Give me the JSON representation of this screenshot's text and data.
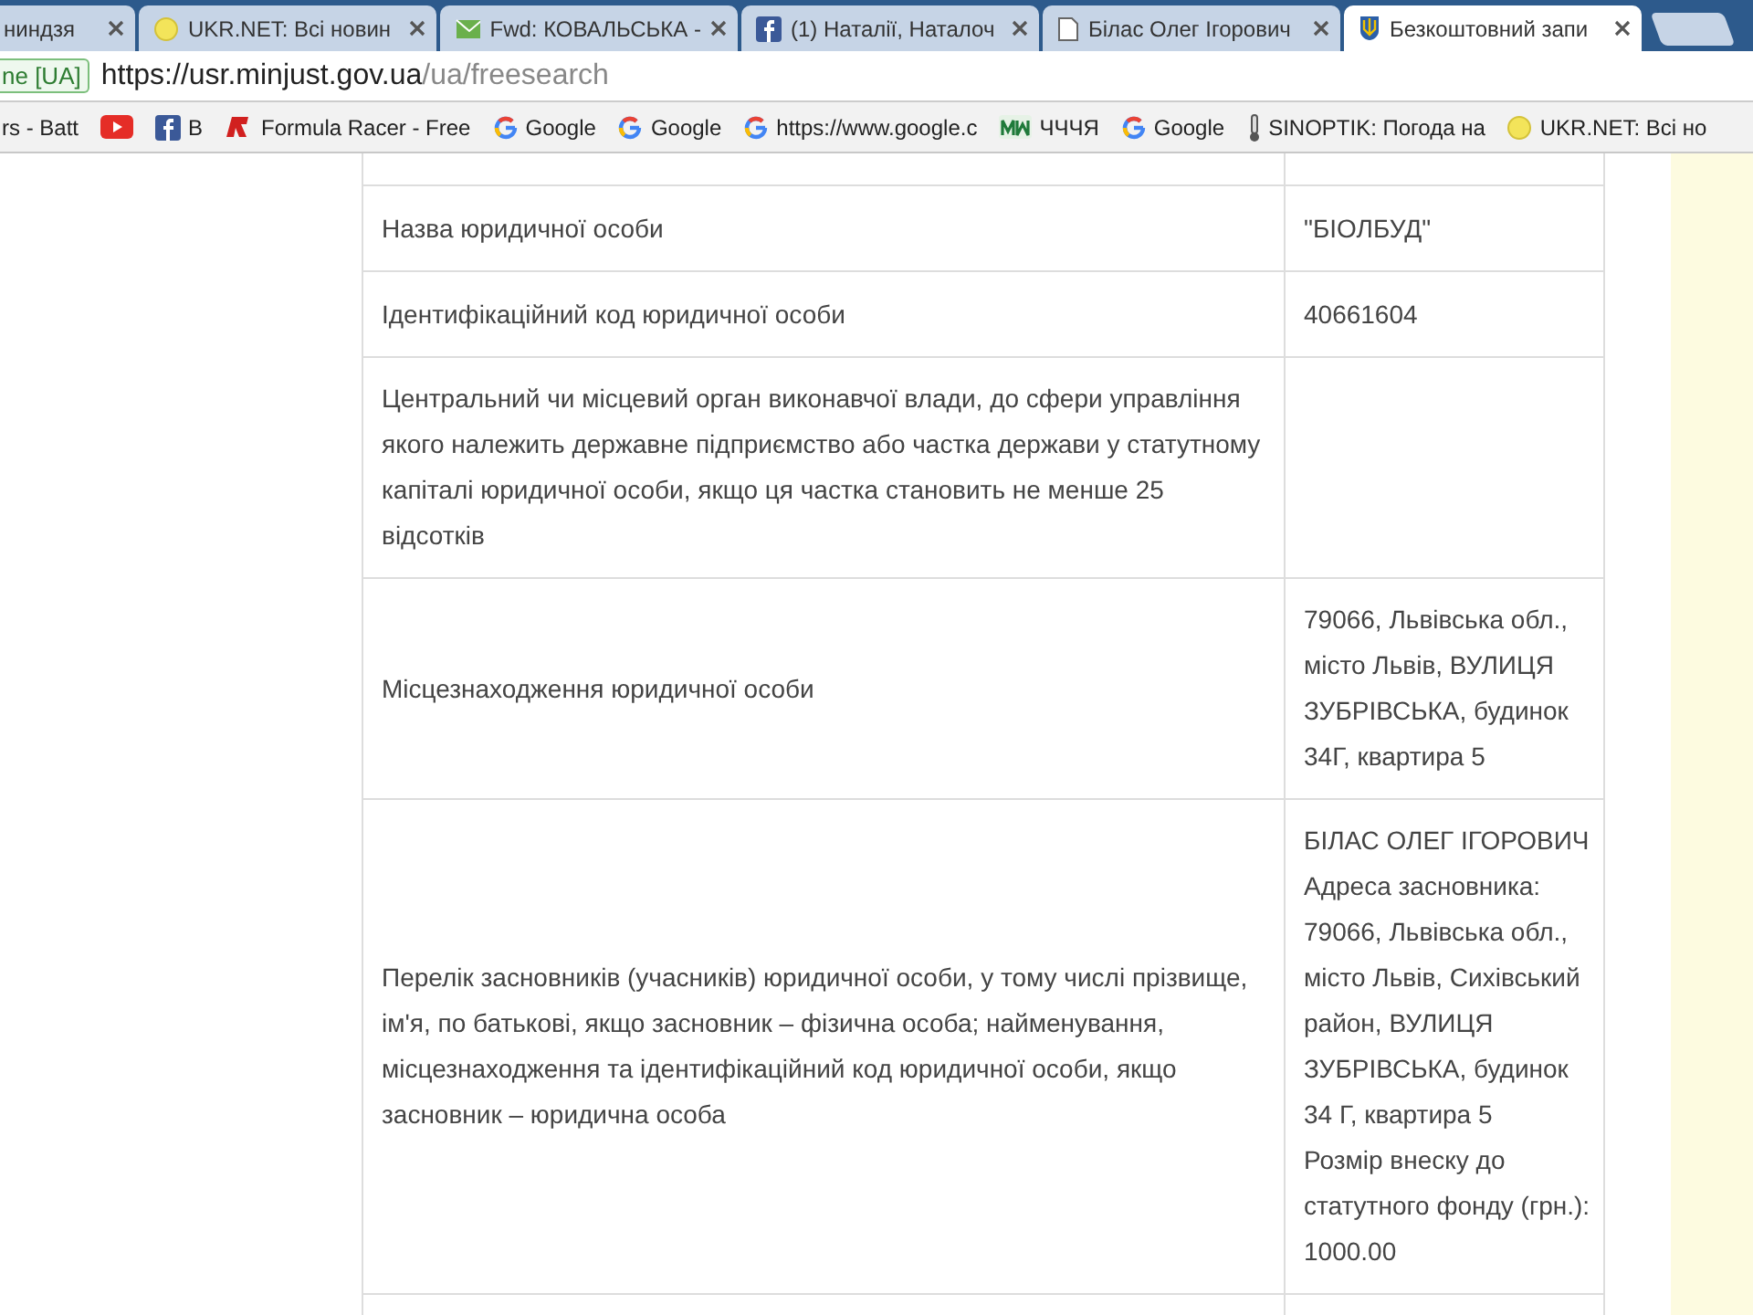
{
  "tabs": [
    {
      "title": "ниндзя",
      "kind": "plain",
      "selected": false
    },
    {
      "title": "UKR.NET: Всі новин",
      "kind": "ukrnet",
      "selected": false
    },
    {
      "title": "Fwd: КОВАЛЬСЬКА -",
      "kind": "mail",
      "selected": false
    },
    {
      "title": "(1) Наталії, Наталоч",
      "kind": "facebook",
      "selected": false
    },
    {
      "title": "Білас Олег Ігорович",
      "kind": "page",
      "selected": false
    },
    {
      "title": "Безкоштовний запи",
      "kind": "arms",
      "selected": true
    }
  ],
  "address_bar": {
    "security_chip": "ne [UA]",
    "url_host": "https://usr.minjust.gov.ua",
    "url_path": "/ua/freesearch"
  },
  "bookmarks": [
    {
      "label": "rs - Batt",
      "kind": "plain"
    },
    {
      "kind": "youtube"
    },
    {
      "label": "B",
      "kind": "facebook"
    },
    {
      "label": "Formula Racer - Free",
      "kind": "racer"
    },
    {
      "label": "Google",
      "kind": "google"
    },
    {
      "label": "Google",
      "kind": "google"
    },
    {
      "label": "https://www.google.c",
      "kind": "google"
    },
    {
      "label": "ЧЧЧЯ",
      "kind": "green"
    },
    {
      "label": "Google",
      "kind": "google"
    },
    {
      "label": "SINOPTIK: Погода на",
      "kind": "thermo"
    },
    {
      "label": "UKR.NET: Всі но",
      "kind": "ukrnet"
    }
  ],
  "table": {
    "rows": [
      {
        "label": "Назва юридичної особи",
        "value": [
          "\"БІОЛБУД\""
        ]
      },
      {
        "label": "Ідентифікаційний код юридичної особи",
        "value": [
          "40661604"
        ]
      },
      {
        "label": "Центральний чи місцевий орган виконавчої влади, до сфери управління якого належить державне підприємство або частка держави у статутному капіталі юридичної особи, якщо ця частка становить не менше 25 відсотків",
        "value": []
      },
      {
        "label": "Місцезнаходження юридичної особи",
        "value": [
          "79066, Львівська обл.,",
          "місто Львів, ВУЛИЦЯ",
          "ЗУБРІВСЬКА, будинок",
          "34Г, квартира 5"
        ]
      },
      {
        "label": "Перелік засновників (учасників) юридичної особи, у тому числі прізвище, ім'я, по батькові, якщо засновник – фізична особа; найменування, місцезнаходження та ідентифікаційний код юридичної особи, якщо засновник – юридична особа",
        "value": [
          "БІЛАС ОЛЕГ ІГОРОВИЧ",
          "Адреса засновника:",
          "79066, Львівська обл.,",
          "місто Львів, Сихівський",
          "район, ВУЛИЦЯ",
          "ЗУБРІВСЬКА, будинок",
          "34 Г, квартира 5",
          "Розмір внеску до",
          "статутного фонду (грн.):",
          "1000.00"
        ]
      }
    ]
  }
}
